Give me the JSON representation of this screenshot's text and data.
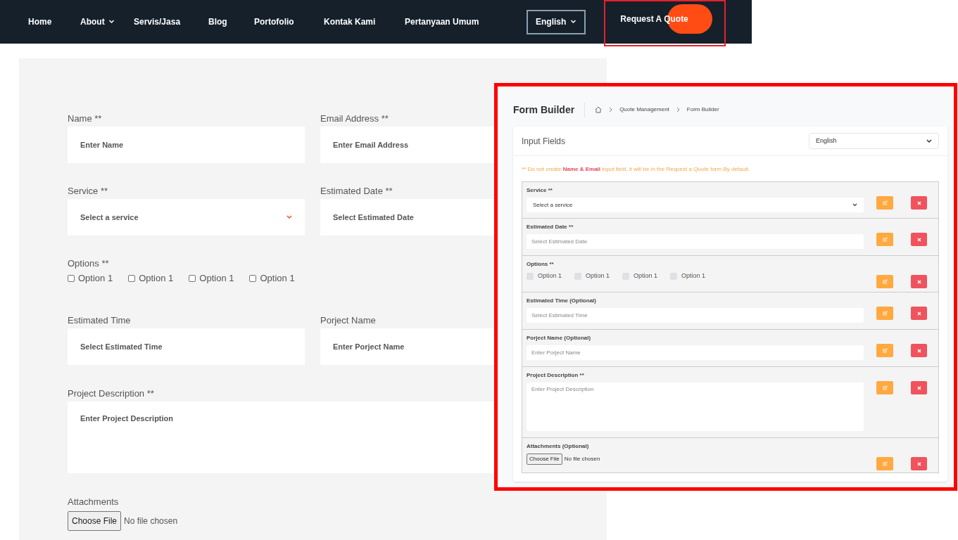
{
  "nav": {
    "items": [
      {
        "label": "Home",
        "dropdown": false
      },
      {
        "label": "About",
        "dropdown": true
      },
      {
        "label": "Servis/Jasa",
        "dropdown": false
      },
      {
        "label": "Blog",
        "dropdown": false
      },
      {
        "label": "Portofolio",
        "dropdown": false
      },
      {
        "label": "Kontak Kami",
        "dropdown": false
      },
      {
        "label": "Pertanyaan Umum",
        "dropdown": false
      }
    ],
    "language": "English",
    "cta": "Request A Quote"
  },
  "quote_form": {
    "rows": [
      [
        {
          "kind": "text",
          "label": "Name **",
          "placeholder": "Enter Name"
        },
        {
          "kind": "text",
          "label": "Email Address **",
          "placeholder": "Enter Email Address"
        }
      ],
      [
        {
          "kind": "select",
          "label": "Service **",
          "placeholder": "Select a service"
        },
        {
          "kind": "text",
          "label": "Estimated Date **",
          "placeholder": "Select Estimated Date"
        }
      ],
      [
        {
          "kind": "checkboxes",
          "label": "Options **",
          "options": [
            {
              "label": "Option 1",
              "checked": false
            },
            {
              "label": "Option 1",
              "checked": false
            },
            {
              "label": "Option 1",
              "checked": false
            },
            {
              "label": "Option 1",
              "checked": false
            }
          ]
        }
      ],
      [
        {
          "kind": "text",
          "label": "Estimated Time",
          "placeholder": "Select Estimated Time"
        },
        {
          "kind": "text",
          "label": "Porject Name",
          "placeholder": "Enter Porject Name"
        }
      ],
      [
        {
          "kind": "textarea",
          "label": "Project Description **",
          "placeholder": "Enter Project Description"
        }
      ],
      [
        {
          "kind": "file",
          "label": "Attachments",
          "button": "Choose File",
          "status": "No file chosen"
        }
      ]
    ]
  },
  "form_builder": {
    "title": "Form Builder",
    "breadcrumb": [
      "Quote Management",
      "Form Builder"
    ],
    "card_title": "Input Fields",
    "language": "English",
    "note": {
      "before": "** Do not create ",
      "highlight": "Name & Email",
      "after": " input field, it will be in the Request a Quote form By default."
    },
    "fields": [
      {
        "kind": "select",
        "label": "Service **",
        "placeholder": "Select a service"
      },
      {
        "kind": "text",
        "label": "Estimated Date **",
        "placeholder": "Select Estimated Date"
      },
      {
        "kind": "checkboxes",
        "label": "Options **",
        "options": [
          {
            "label": "Option 1",
            "checked": false
          },
          {
            "label": "Option 1",
            "checked": false
          },
          {
            "label": "Option 1",
            "checked": false
          },
          {
            "label": "Option 1",
            "checked": false
          }
        ]
      },
      {
        "kind": "text",
        "label": "Estimated Time (Optional)",
        "placeholder": "Select Estimated Time"
      },
      {
        "kind": "text",
        "label": "Porject Name (Optional)",
        "placeholder": "Enter Porject Name"
      },
      {
        "kind": "textarea",
        "label": "Project Description **",
        "placeholder": "Enter Project Description"
      },
      {
        "kind": "file",
        "label": "Attachments (Optional)",
        "button": "Choose File",
        "status": "No file chosen"
      }
    ]
  }
}
